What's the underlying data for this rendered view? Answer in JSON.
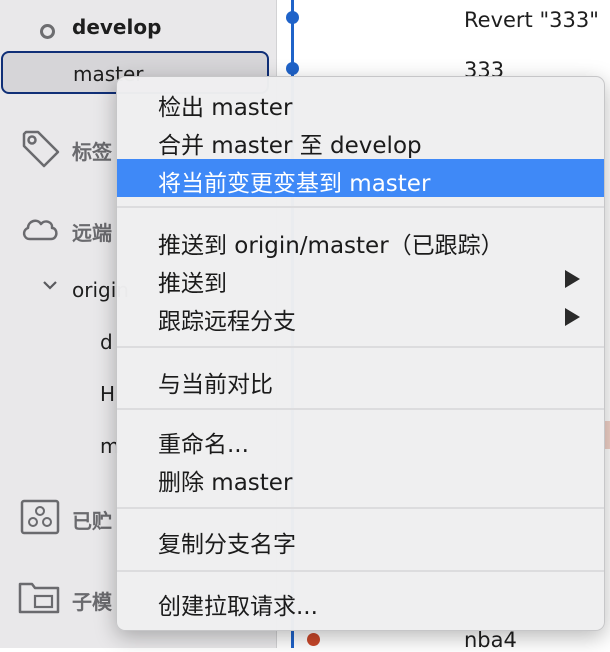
{
  "sidebar": {
    "develop_label": "develop",
    "master_label": "master",
    "tags_label": "标签",
    "remotes_label": "远端",
    "origin_label": "origin",
    "remote_branches": [
      "d",
      "H",
      "m"
    ],
    "stashes_label": "已贮",
    "submodules_label": "子模"
  },
  "commits": [
    {
      "message": "Revert \"333\""
    },
    {
      "message": "333"
    },
    {
      "message": "nba4"
    }
  ],
  "context_menu": {
    "items": [
      {
        "label": "检出 master"
      },
      {
        "label": "合并 master 至 develop"
      },
      {
        "label": "将当前变更变基到 master",
        "highlighted": true
      },
      {
        "label": "推送到 origin/master（已跟踪）"
      },
      {
        "label": "推送到",
        "submenu": true
      },
      {
        "label": "跟踪远程分支",
        "submenu": true
      },
      {
        "label": "与当前对比"
      },
      {
        "label": "重命名..."
      },
      {
        "label": "删除 master"
      },
      {
        "label": "复制分支名字"
      },
      {
        "label": "创建拉取请求..."
      }
    ]
  },
  "colors": {
    "graph_line": "#1f63c9",
    "graph_dot_alt": "#c9482a",
    "selection_border": "#102f77",
    "menu_highlight": "#3f89f7"
  }
}
